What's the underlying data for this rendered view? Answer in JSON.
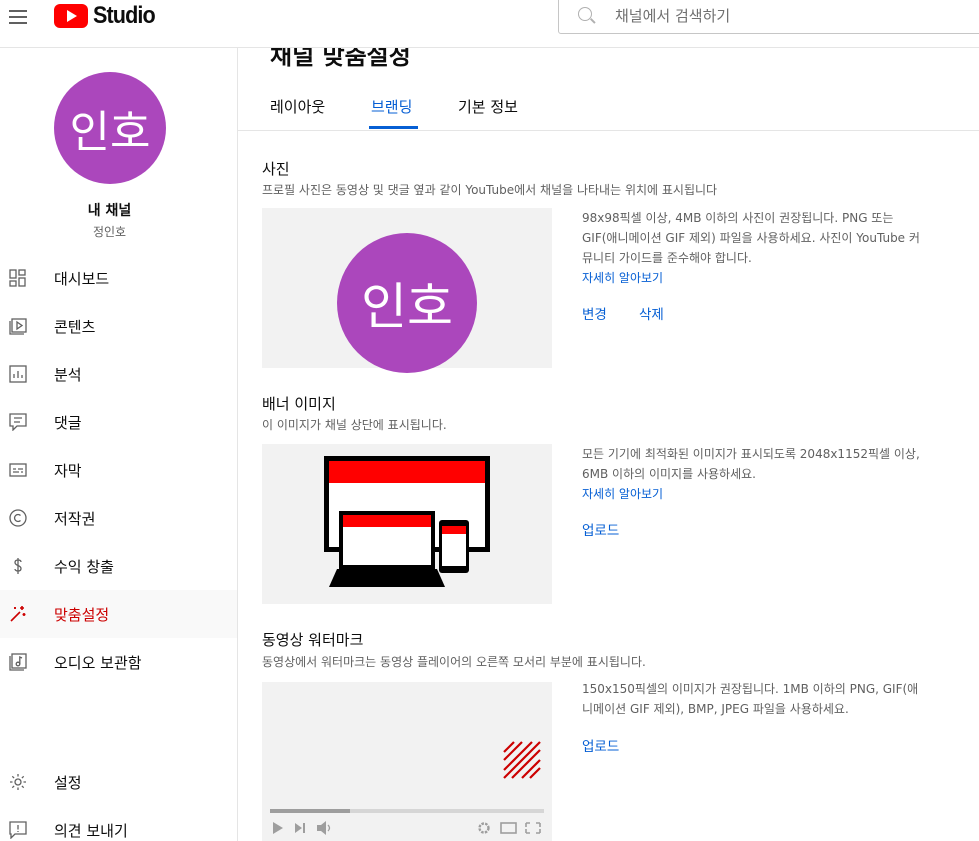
{
  "search": {
    "placeholder": "채널에서 검색하기"
  },
  "logo": {
    "text": "Studio"
  },
  "channel": {
    "avatar_text": "인호",
    "title": "내 채널",
    "owner": "정인호"
  },
  "sidebar": {
    "items": [
      {
        "label": "대시보드"
      },
      {
        "label": "콘텐츠"
      },
      {
        "label": "분석"
      },
      {
        "label": "댓글"
      },
      {
        "label": "자막"
      },
      {
        "label": "저작권"
      },
      {
        "label": "수익 창출"
      },
      {
        "label": "맞춤설정"
      },
      {
        "label": "오디오 보관함"
      },
      {
        "label": "설정"
      },
      {
        "label": "의견 보내기"
      }
    ]
  },
  "page": {
    "title": "채널 맞춤설정"
  },
  "tabs": [
    {
      "label": "레이아웃"
    },
    {
      "label": "브랜딩"
    },
    {
      "label": "기본 정보"
    }
  ],
  "photo": {
    "title": "사진",
    "desc": "프로필 사진은 동영상 및 댓글 옆과 같이 YouTube에서 채널을 나타내는 위치에 표시됩니다",
    "info": "98x98픽셀 이상, 4MB 이하의 사진이 권장됩니다. PNG 또는 GIF(애니메이션 GIF 제외) 파일을 사용하세요. 사진이 YouTube 커뮤니티 가이드를 준수해야 합니다.",
    "learn_more": "자세히 알아보기",
    "change": "변경",
    "delete": "삭제"
  },
  "banner": {
    "title": "배너 이미지",
    "desc": "이 이미지가 채널 상단에 표시됩니다.",
    "info": "모든 기기에 최적화된 이미지가 표시되도록 2048x1152픽셀 이상, 6MB 이하의 이미지를 사용하세요.",
    "learn_more": "자세히 알아보기",
    "upload": "업로드"
  },
  "watermark": {
    "title": "동영상 워터마크",
    "desc": "동영상에서 워터마크는 동영상 플레이어의 오른쪽 모서리 부분에 표시됩니다.",
    "info": "150x150픽셀의 이미지가 권장됩니다. 1MB 이하의 PNG, GIF(애니메이션 GIF 제외), BMP, JPEG 파일을 사용하세요.",
    "upload": "업로드"
  },
  "colors": {
    "accent": "#065fd4",
    "active_red": "#cc0000",
    "avatar": "#ab47bc",
    "brand_red": "#ff0000"
  }
}
